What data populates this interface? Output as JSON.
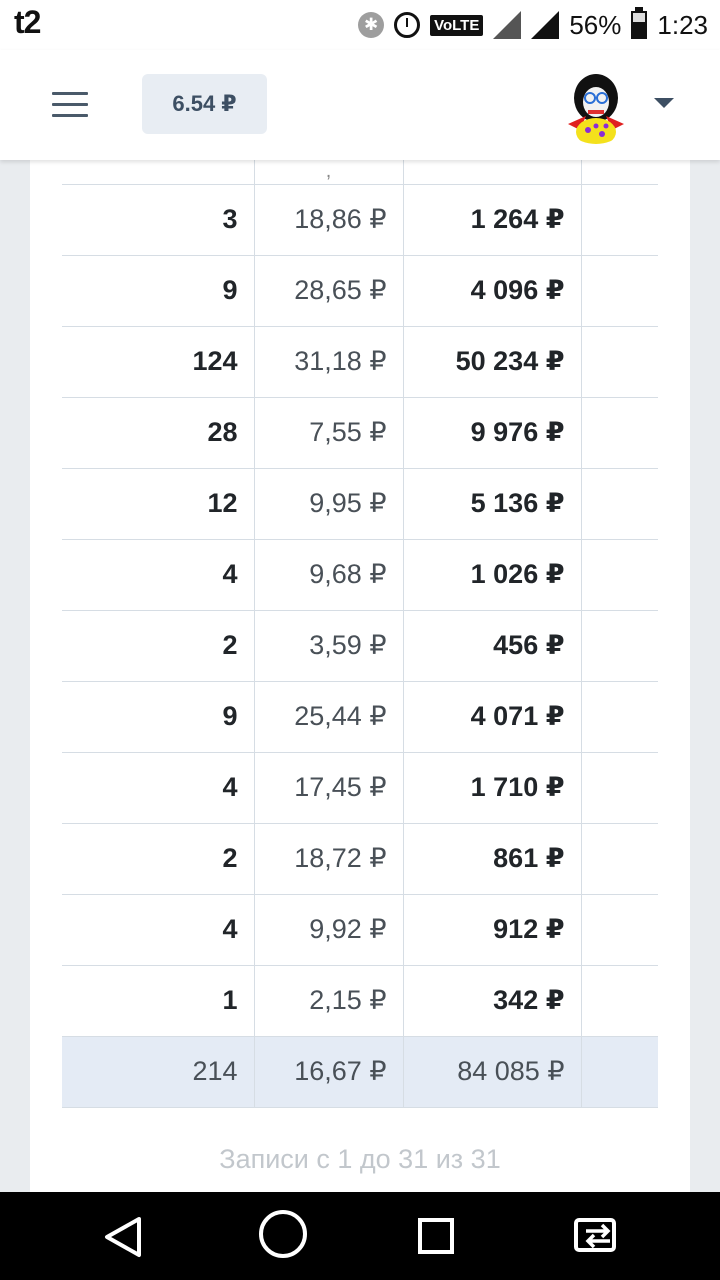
{
  "status_bar": {
    "carrier": "t2",
    "volte": "VoLTE",
    "network": "4G",
    "battery": "56%",
    "time": "1:23"
  },
  "header": {
    "balance": "6.54 ₽",
    "menu_icon": "hamburger-icon",
    "caret_icon": "chevron-down-icon"
  },
  "table": {
    "partial_row": {
      "price_fragment": ","
    },
    "rows": [
      {
        "qty": "3",
        "price": "18,86 ₽",
        "sum": "1 264 ₽"
      },
      {
        "qty": "9",
        "price": "28,65 ₽",
        "sum": "4 096 ₽"
      },
      {
        "qty": "124",
        "price": "31,18 ₽",
        "sum": "50 234 ₽"
      },
      {
        "qty": "28",
        "price": "7,55 ₽",
        "sum": "9 976 ₽"
      },
      {
        "qty": "12",
        "price": "9,95 ₽",
        "sum": "5 136 ₽"
      },
      {
        "qty": "4",
        "price": "9,68 ₽",
        "sum": "1 026 ₽"
      },
      {
        "qty": "2",
        "price": "3,59 ₽",
        "sum": "456 ₽"
      },
      {
        "qty": "9",
        "price": "25,44 ₽",
        "sum": "4 071 ₽"
      },
      {
        "qty": "4",
        "price": "17,45 ₽",
        "sum": "1 710 ₽"
      },
      {
        "qty": "2",
        "price": "18,72 ₽",
        "sum": "861 ₽"
      },
      {
        "qty": "4",
        "price": "9,92 ₽",
        "sum": "912 ₽"
      },
      {
        "qty": "1",
        "price": "2,15 ₽",
        "sum": "342 ₽"
      }
    ],
    "total": {
      "qty": "214",
      "price": "16,67 ₽",
      "sum": "84 085 ₽"
    }
  },
  "records_info": "Записи с 1 до 31 из 31",
  "nav": {
    "back_icon": "back-icon",
    "home_icon": "home-icon",
    "recent_icon": "recent-apps-icon",
    "switch_icon": "switch-app-icon"
  }
}
